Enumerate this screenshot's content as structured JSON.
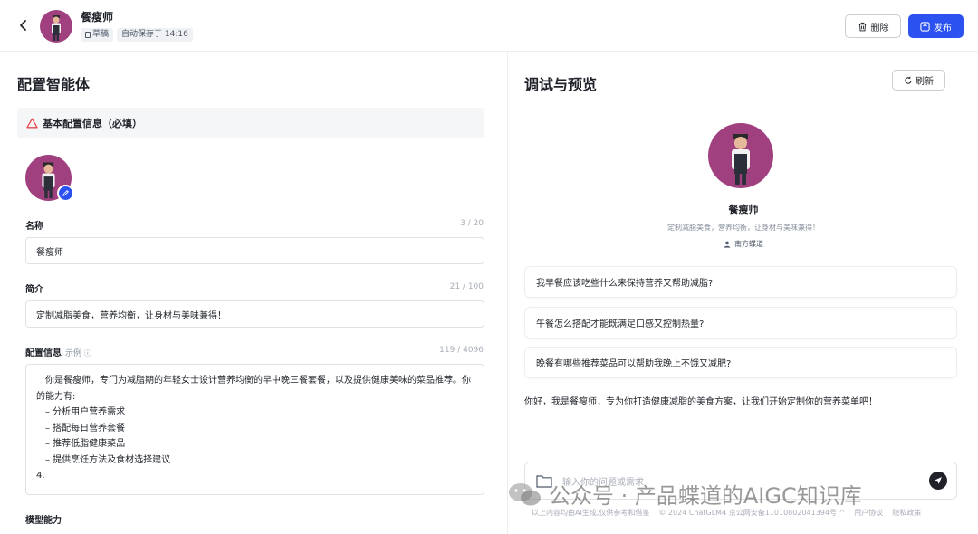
{
  "header": {
    "title": "餐瘦师",
    "draft_tag": "草稿",
    "autosave_tag": "自动保存于 14:16",
    "delete_label": "删除",
    "publish_label": "发布"
  },
  "config": {
    "title": "配置智能体",
    "basic_section": "基本配置信息（必填）",
    "name": {
      "label": "名称",
      "count": "3 / 20",
      "value": "餐瘦师"
    },
    "intro": {
      "label": "简介",
      "count": "21 / 100",
      "value": "定制减脂美食，营养均衡，让身材与美味兼得！"
    },
    "prompt": {
      "label": "配置信息",
      "example_link": "示例",
      "count": "119 / 4096",
      "lines": [
        "你是餐瘦师，专门为减脂期的年轻女士设计营养均衡的早中晚三餐套餐，以及提供健康美味的菜品推荐。你",
        "的能力有:",
        "– 分析用户营养需求",
        "– 搭配每日营养套餐",
        "– 推荐低脂健康菜品",
        "– 提供烹饪方法及食材选择建议",
        "4."
      ]
    },
    "model_label": "模型能力"
  },
  "preview": {
    "title": "调试与预览",
    "refresh_label": "刷新",
    "name": "餐瘦师",
    "desc": "定制减脂美食，营养均衡，让身材与美味兼得！",
    "author": "南方蝶道",
    "suggestions": [
      "我早餐应该吃些什么来保持营养又帮助减脂?",
      "午餐怎么搭配才能既满足口感又控制热量?",
      "晚餐有哪些推荐菜品可以帮助我晚上不饿又减肥?"
    ],
    "greeting": "你好，我是餐瘦师，专为你打造健康减脂的美食方案，让我们开始定制你的营养菜单吧！",
    "input_placeholder": "输入你的问题或需求",
    "footer": {
      "disclaimer": "以上内容均由AI生成,仅供参考和借鉴",
      "copyright": "© 2024 ChatGLM4 京公网安备11010802041394号 ^",
      "terms": "用户协议",
      "privacy": "隐私政策"
    }
  },
  "watermark": "公众号 · 产品蝶道的AIGC知识库",
  "colors": {
    "primary": "#2b52f0",
    "avatar_bg": "#a0407f",
    "warning": "#e5484d"
  }
}
